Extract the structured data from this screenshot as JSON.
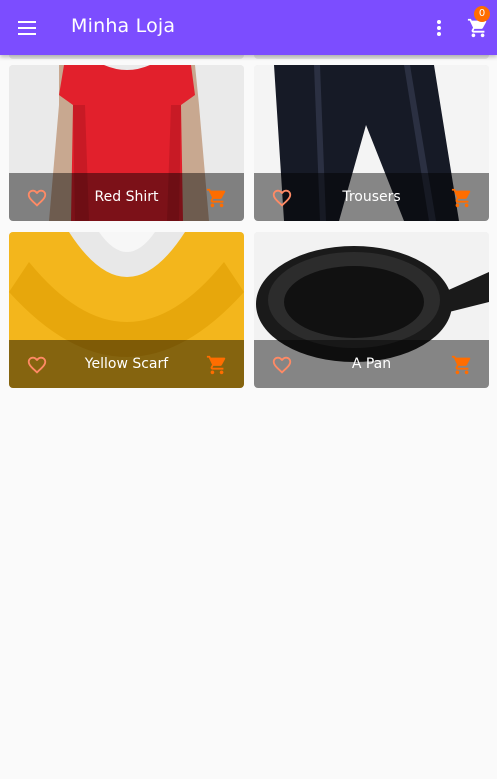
{
  "app": {
    "title": "Minha Loja",
    "accent": "#7c4dff",
    "badge_color": "#ff6d00",
    "cart_count": "0",
    "icons": {
      "menu": "menu-icon",
      "more": "more-vert-icon",
      "cart": "shopping-cart-icon",
      "favorite": "favorite-border-icon",
      "add_to_cart": "add-shopping-cart-icon"
    }
  },
  "products": [
    {
      "name": "Red Shirt",
      "image": "red t-shirt"
    },
    {
      "name": "Trousers",
      "image": "black trousers"
    },
    {
      "name": "Yellow Scarf",
      "image": "yellow knitted scarf"
    },
    {
      "name": "A Pan",
      "image": "cast iron pan"
    }
  ],
  "colors": {
    "favorite_icon": "#ff8a65",
    "cart_icon": "#ff6d00",
    "bar_overlay": "rgba(0,0,0,0.45)"
  }
}
